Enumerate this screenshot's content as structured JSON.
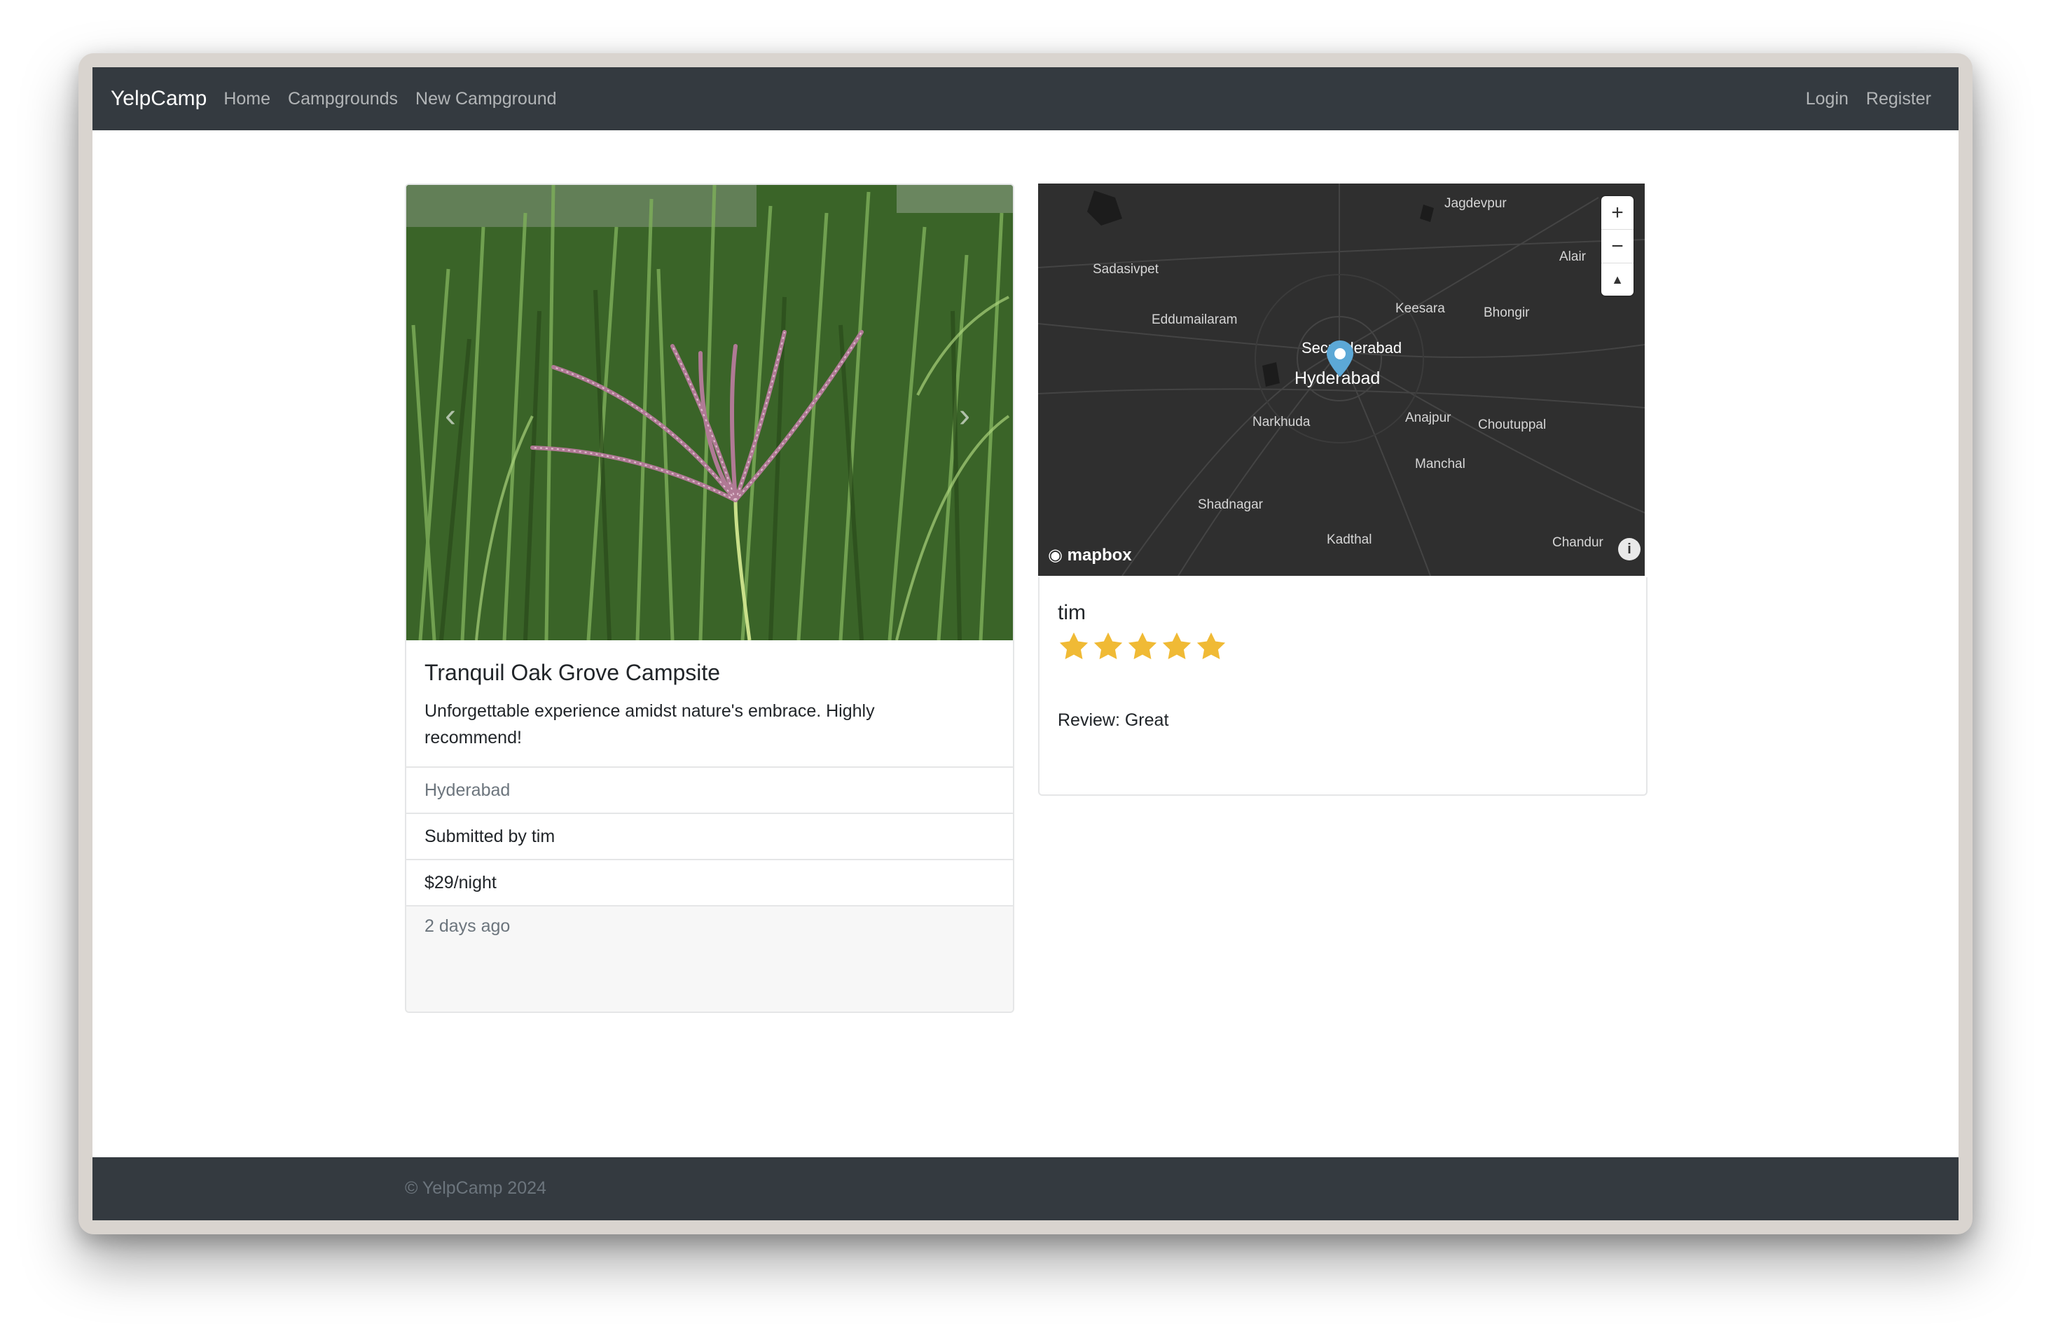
{
  "navbar": {
    "brand": "YelpCamp",
    "links": [
      "Home",
      "Campgrounds",
      "New Campground"
    ],
    "right_links": [
      "Login",
      "Register"
    ]
  },
  "campground": {
    "title": "Tranquil Oak Grove Campsite",
    "description": "Unforgettable experience amidst nature's embrace. Highly recommend!",
    "location": "Hyderabad",
    "submitted_by": "Submitted by tim",
    "price": "$29/night",
    "posted": "2 days ago",
    "carousel_prev_icon": "chevron-left-icon",
    "carousel_next_icon": "chevron-right-icon"
  },
  "map": {
    "labels": [
      "Jagdevpur",
      "Alair",
      "Sadasivpet",
      "Eddumailaram",
      "Keesara",
      "Bhongir",
      "Secunderabad",
      "Hyderabad",
      "Narkhuda",
      "Anajpur",
      "Choutuppal",
      "Manchal",
      "Shadnagar",
      "Kadthal",
      "Chandur"
    ],
    "logo": "mapbox",
    "zoom_in": "+",
    "zoom_out": "−",
    "compass": "▲"
  },
  "review": {
    "author": "tim",
    "rating": 5,
    "max_rating": 5,
    "text": "Review: Great",
    "star_color": "#f0ba35"
  },
  "footer": {
    "text": "© YelpCamp 2024"
  }
}
